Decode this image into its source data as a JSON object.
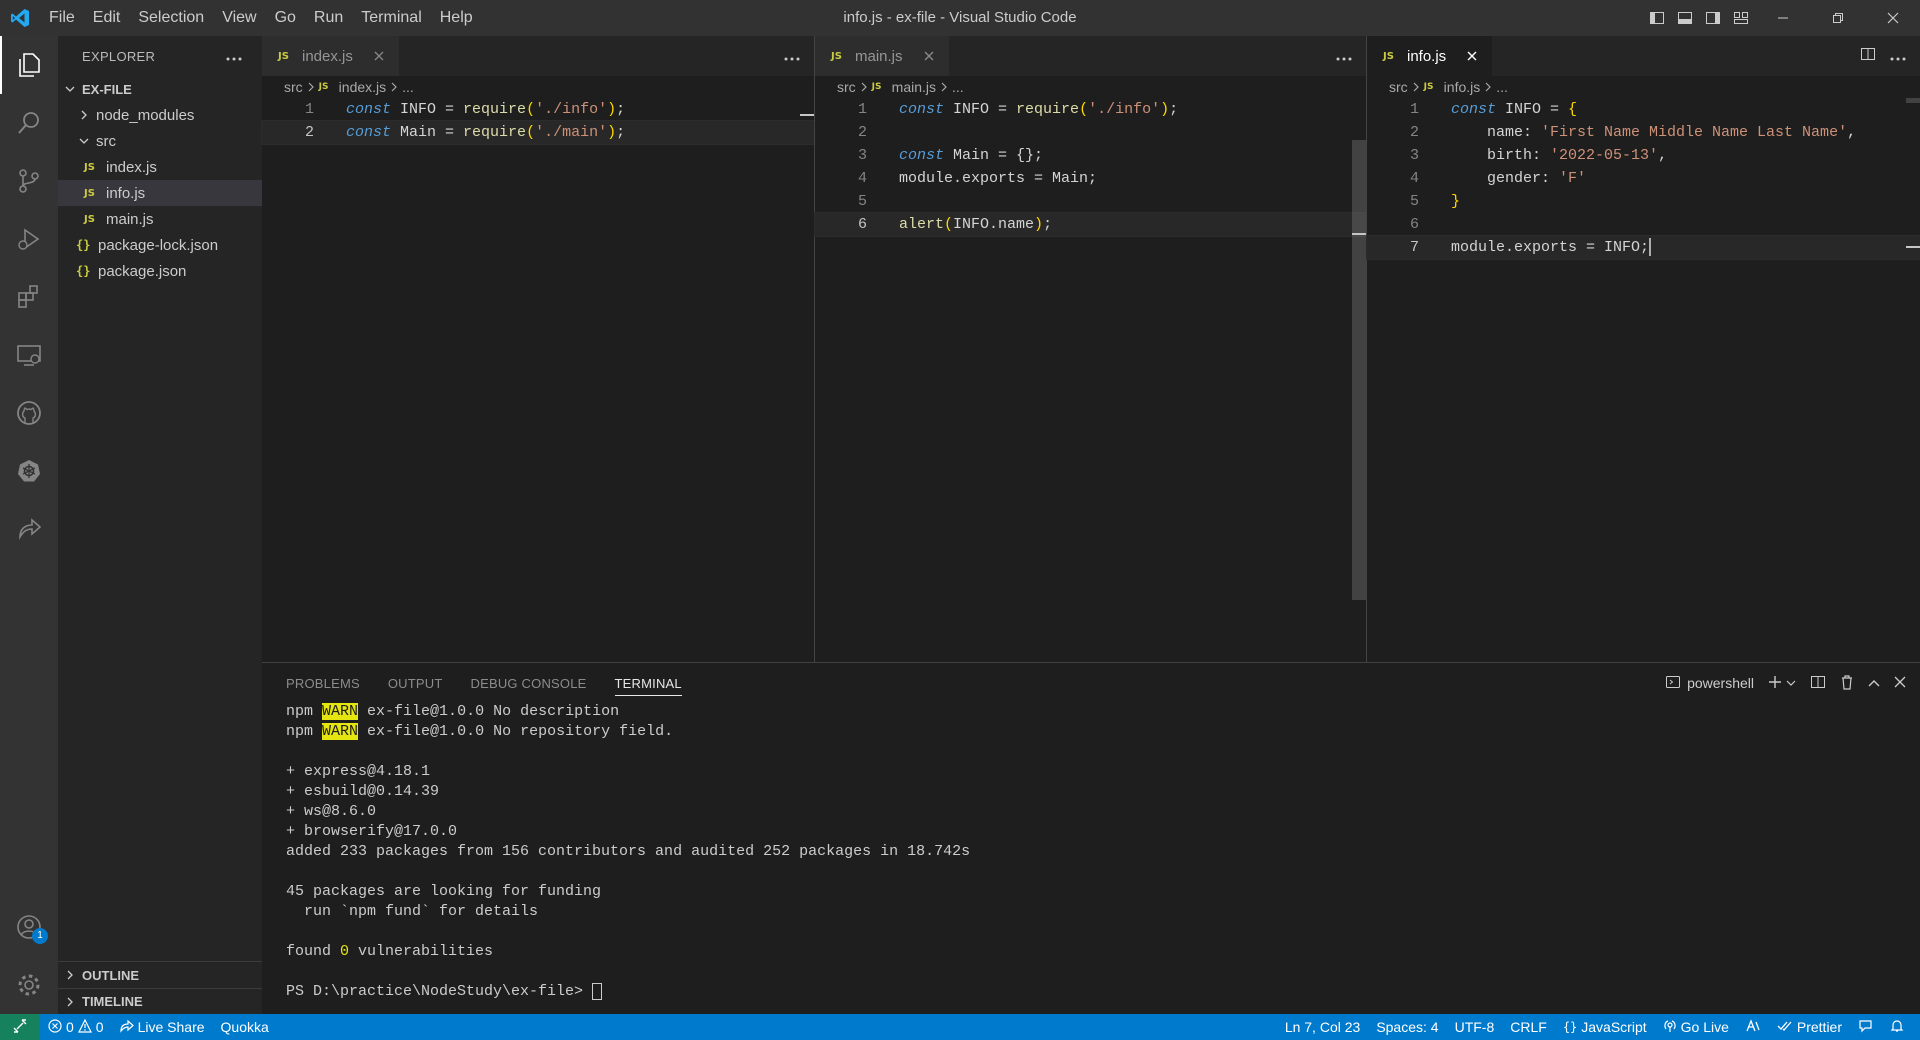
{
  "window": {
    "title": "info.js - ex-file - Visual Studio Code"
  },
  "menu": [
    "File",
    "Edit",
    "Selection",
    "View",
    "Go",
    "Run",
    "Terminal",
    "Help"
  ],
  "sidebar": {
    "title": "EXPLORER",
    "root": "EX-FILE",
    "tree": [
      {
        "label": "node_modules",
        "kind": "folder"
      },
      {
        "label": "src",
        "kind": "folder"
      },
      {
        "label": "index.js",
        "kind": "js"
      },
      {
        "label": "info.js",
        "kind": "js",
        "selected": true
      },
      {
        "label": "main.js",
        "kind": "js"
      },
      {
        "label": "package-lock.json",
        "kind": "json"
      },
      {
        "label": "package.json",
        "kind": "json"
      }
    ],
    "outline": "OUTLINE",
    "timeline": "TIMELINE",
    "accounts_badge": "1"
  },
  "editors": [
    {
      "tab": "index.js",
      "breadcrumb": {
        "folder": "src",
        "file": "index.js",
        "ellipsis": "..."
      },
      "line_numbers": [
        "1",
        "2"
      ]
    },
    {
      "tab": "main.js",
      "breadcrumb": {
        "folder": "src",
        "file": "main.js",
        "ellipsis": "..."
      },
      "line_numbers": [
        "1",
        "2",
        "3",
        "4",
        "5",
        "6"
      ]
    },
    {
      "tab": "info.js",
      "breadcrumb": {
        "folder": "src",
        "file": "info.js",
        "ellipsis": "..."
      },
      "line_numbers": [
        "1",
        "2",
        "3",
        "4",
        "5",
        "6",
        "7"
      ]
    }
  ],
  "code": {
    "kw_const": "const",
    "idx_l1_name": " INFO ",
    "idx_l1_eq": "= ",
    "fn_require": "require",
    "idx_l1_arg": "'./info'",
    "idx_l2_name": " Main ",
    "idx_l2_arg": "'./main'",
    "paren_open": "(",
    "paren_close": ")",
    "semi": ";",
    "main_l3_rest": " Main = {};",
    "main_l4": "module.exports = Main;",
    "fn_alert": "alert",
    "main_l6_arg": "INFO.name",
    "info_l1_rest": " INFO = ",
    "brace_open": "{",
    "brace_close": "}",
    "info_l2_key": "    name: ",
    "info_l2_val": "'First Name Middle Name Last Name'",
    "comma": ",",
    "info_l3_key": "    birth: ",
    "info_l3_val": "'2022-05-13'",
    "info_l4_key": "    gender: ",
    "info_l4_val": "'F'",
    "info_l7": "module.exports = INFO;"
  },
  "panel": {
    "tabs": [
      "PROBLEMS",
      "OUTPUT",
      "DEBUG CONSOLE",
      "TERMINAL"
    ],
    "shell": "powershell",
    "npm": "npm",
    "warn": "WARN",
    "l1": " ex-file@1.0.0 No description",
    "l2": " ex-file@1.0.0 No repository field.",
    "l4": "+ express@4.18.1",
    "l5": "+ esbuild@0.14.39",
    "l6": "+ ws@8.6.0",
    "l7": "+ browserify@17.0.0",
    "l8": "added 233 packages from 156 contributors and audited 252 packages in 18.742s",
    "l10": "45 packages are looking for funding",
    "l11": "  run `npm fund` for details",
    "l13a": "found ",
    "l13b": "0",
    "l13c": " vulnerabilities",
    "prompt": "PS D:\\practice\\NodeStudy\\ex-file> "
  },
  "status": {
    "errors": "0",
    "warnings": "0",
    "live_share": "Live Share",
    "quokka": "Quokka",
    "position": "Ln 7, Col 23",
    "spaces": "Spaces: 4",
    "encoding": "UTF-8",
    "eol": "CRLF",
    "language": "JavaScript",
    "go_live": "Go Live",
    "prettier": "Prettier"
  },
  "colors": {
    "statusbar": "#007acc",
    "remote": "#16825d",
    "js_badge": "#cbcb41",
    "keyword": "#569cd6",
    "function": "#dcdcaa",
    "string": "#ce9178"
  }
}
